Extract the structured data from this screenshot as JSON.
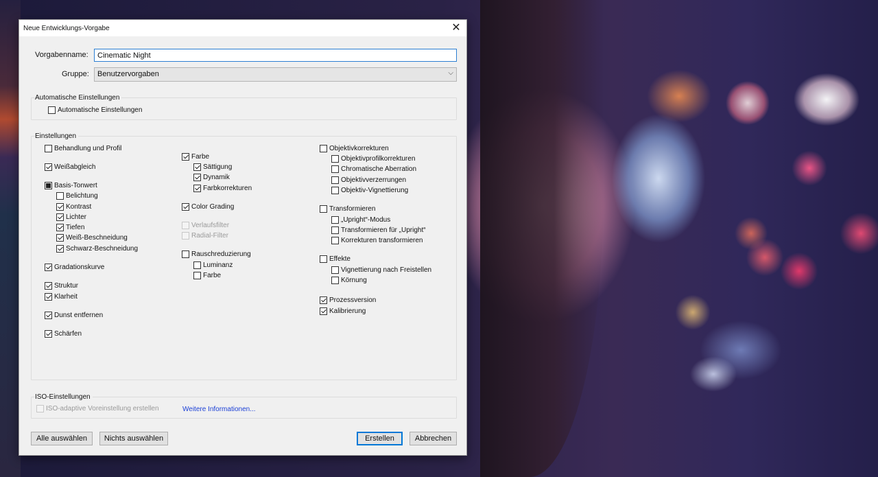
{
  "dialog": {
    "title": "Neue Entwicklungs-Vorgabe",
    "name_label": "Vorgabenname:",
    "name_value": "Cinematic Night",
    "group_label": "Gruppe:",
    "group_value": "Benutzervorgaben"
  },
  "auto": {
    "title": "Automatische Einstellungen",
    "checkbox_label": "Automatische Einstellungen"
  },
  "settings": {
    "title": "Einstellungen",
    "col1": {
      "behandlung": "Behandlung und Profil",
      "weissabgleich": "Weißabgleich",
      "basis": "Basis-Tonwert",
      "belichtung": "Belichtung",
      "kontrast": "Kontrast",
      "lichter": "Lichter",
      "tiefen": "Tiefen",
      "weiss_beschneidung": "Weiß-Beschneidung",
      "schwarz_beschneidung": "Schwarz-Beschneidung",
      "gradationskurve": "Gradationskurve",
      "struktur": "Struktur",
      "klarheit": "Klarheit",
      "dunst": "Dunst entfernen",
      "schaerfen": "Schärfen"
    },
    "col2": {
      "farbe": "Farbe",
      "saettigung": "Sättigung",
      "dynamik": "Dynamik",
      "farbkorrekturen": "Farbkorrekturen",
      "color_grading": "Color Grading",
      "verlaufsfilter": "Verlaufsfilter",
      "radial_filter": "Radial-Filter",
      "rauschreduzierung": "Rauschreduzierung",
      "luminanz": "Luminanz",
      "farbe2": "Farbe"
    },
    "col3": {
      "objektivkorrekturen": "Objektivkorrekturen",
      "objektivprofil": "Objektivprofilkorrekturen",
      "chromatische": "Chromatische Aberration",
      "verzerrungen": "Objektivverzerrungen",
      "vignettierung": "Objektiv-Vignettierung",
      "transformieren": "Transformieren",
      "upright_modus": "„Upright“-Modus",
      "transf_upright": "Transformieren für „Upright“",
      "korrekturen_transf": "Korrekturen transformieren",
      "effekte": "Effekte",
      "vignettierung_freistellen": "Vignettierung nach Freistellen",
      "koernung": "Körnung",
      "prozessversion": "Prozessversion",
      "kalibrierung": "Kalibrierung"
    }
  },
  "iso": {
    "title": "ISO-Einstellungen",
    "checkbox_label": "ISO-adaptive Voreinstellung erstellen",
    "link": "Weitere Informationen..."
  },
  "buttons": {
    "select_all": "Alle auswählen",
    "select_none": "Nichts auswählen",
    "create": "Erstellen",
    "cancel": "Abbrechen"
  },
  "icons": {
    "close": "close-icon",
    "dropdown": "chevron-down-icon"
  }
}
